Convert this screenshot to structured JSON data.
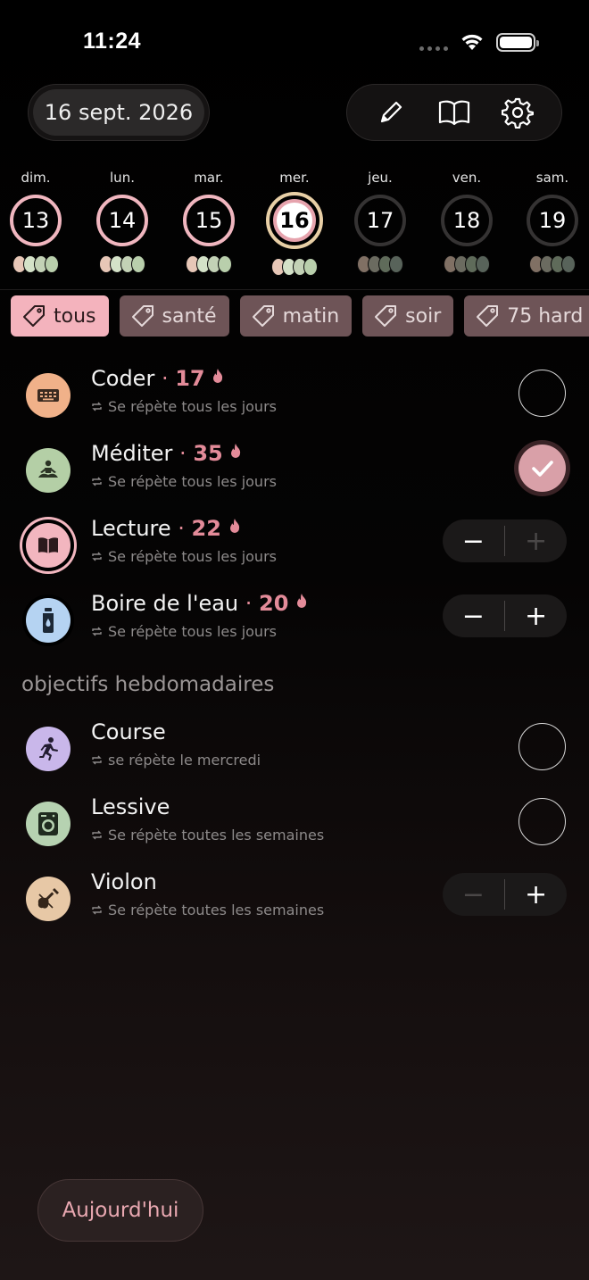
{
  "status": {
    "time": "11:24"
  },
  "header": {
    "date": "16 sept. 2026"
  },
  "week": [
    {
      "name": "dim.",
      "num": "13",
      "state": "done"
    },
    {
      "name": "lun.",
      "num": "14",
      "state": "done"
    },
    {
      "name": "mar.",
      "num": "15",
      "state": "done"
    },
    {
      "name": "mer.",
      "num": "16",
      "state": "today"
    },
    {
      "name": "jeu.",
      "num": "17",
      "state": "future"
    },
    {
      "name": "ven.",
      "num": "18",
      "state": "future"
    },
    {
      "name": "sam.",
      "num": "19",
      "state": "future"
    }
  ],
  "tags": [
    {
      "label": "tous",
      "active": true
    },
    {
      "label": "santé"
    },
    {
      "label": "matin"
    },
    {
      "label": "soir"
    },
    {
      "label": "75 hard"
    }
  ],
  "daily": [
    {
      "name": "Coder",
      "streak": "17",
      "repeat": "Se répète tous les jours",
      "icon": "keyboard-icon",
      "color": "#f0b189",
      "control": "check",
      "checked": false
    },
    {
      "name": "Méditer",
      "streak": "35",
      "repeat": "Se répète tous les jours",
      "icon": "meditation-icon",
      "color": "#b4cfa6",
      "control": "check",
      "checked": true
    },
    {
      "name": "Lecture",
      "streak": "22",
      "repeat": "Se répète tous les jours",
      "icon": "book-icon",
      "color": "#f2b6bf",
      "control": "stepper"
    },
    {
      "name": "Boire de l'eau",
      "streak": "20",
      "repeat": "Se répète tous les jours",
      "icon": "water-bottle-icon",
      "color": "#b5d3f2",
      "control": "stepper"
    }
  ],
  "weekly_section": "objectifs hebdomadaires",
  "weekly": [
    {
      "name": "Course",
      "repeat": "se répète le mercredi",
      "icon": "running-icon",
      "color": "#c9b7ea",
      "control": "check"
    },
    {
      "name": "Lessive",
      "repeat": "Se répète toutes les semaines",
      "icon": "washing-machine-icon",
      "color": "#b6d2b1",
      "control": "check"
    },
    {
      "name": "Violon",
      "repeat": "Se répète toutes les semaines",
      "icon": "violin-icon",
      "color": "#e7c8a6",
      "control": "stepper"
    }
  ],
  "steppers": {
    "minus": "−",
    "plus": "+"
  },
  "today_button": "Aujourd'hui"
}
